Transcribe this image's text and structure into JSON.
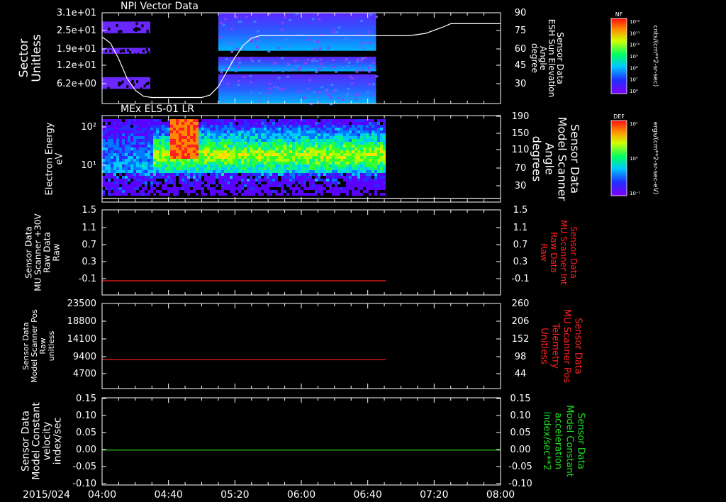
{
  "date_label": "2015/024",
  "time_ticks": [
    "04:00",
    "04:40",
    "05:20",
    "06:00",
    "06:40",
    "07:20",
    "08:00"
  ],
  "colorbars": [
    {
      "tag": "NF",
      "units": "cnts/(cm**2-sr-sec)",
      "tick_labels": [
        "10¹²",
        "10¹¹",
        "10¹⁰",
        "10⁹",
        "10⁸",
        "10⁷",
        "10⁶"
      ]
    },
    {
      "tag": "DEF",
      "units": "ergs/(cm**2-sr-sec-eV)",
      "tick_labels": [
        "10¹",
        "10⁰",
        "10⁻¹"
      ]
    }
  ],
  "chart_data": [
    {
      "type": "heatmap",
      "title": "NPI Vector Data",
      "ylabel_left": [
        "Sector",
        "Unitless"
      ],
      "yticks_left": [
        "3.1e+01",
        "2.5e+01",
        "1.9e+01",
        "1.2e+01",
        "6.2e+00"
      ],
      "ylabel_right": [
        "Sensor Data",
        "ESH Sun Elevation",
        "Angle",
        "degree"
      ],
      "yticks_right": [
        "90",
        "75",
        "60",
        "45",
        "30"
      ],
      "ylim_right": [
        15,
        90
      ],
      "right_series": {
        "color": "#ffffff",
        "points": [
          [
            "04:00",
            70
          ],
          [
            "04:05",
            65
          ],
          [
            "04:10",
            52
          ],
          [
            "04:15",
            36
          ],
          [
            "04:20",
            26
          ],
          [
            "04:25",
            21
          ],
          [
            "04:30",
            20
          ],
          [
            "04:40",
            20
          ],
          [
            "05:00",
            20
          ],
          [
            "05:05",
            22
          ],
          [
            "05:10",
            29
          ],
          [
            "05:15",
            41
          ],
          [
            "05:20",
            53
          ],
          [
            "05:25",
            63
          ],
          [
            "05:30",
            69
          ],
          [
            "05:35",
            71
          ],
          [
            "06:00",
            71
          ],
          [
            "06:30",
            71
          ],
          [
            "06:50",
            71
          ],
          [
            "07:05",
            71
          ],
          [
            "07:15",
            73
          ],
          [
            "07:25",
            78
          ],
          [
            "07:30",
            81
          ],
          [
            "08:00",
            81
          ]
        ]
      },
      "data_blocks": [
        {
          "t_start": "04:00",
          "t_end": "04:29",
          "sector_bands": [
            [
              24,
              28
            ],
            [
              17,
              19
            ],
            [
              5,
              9
            ]
          ],
          "level": "low"
        },
        {
          "t_start": "05:10",
          "t_end": "06:45",
          "sector_bands": [
            [
              18,
              31
            ],
            [
              11,
              16
            ],
            [
              0,
              10
            ]
          ],
          "level": "low-mid"
        }
      ]
    },
    {
      "type": "heatmap",
      "title": "MEx ELS-01 LR",
      "ylabel_left": [
        "Electron Energy",
        "eV"
      ],
      "yticks_left": [
        "10²",
        "10¹"
      ],
      "ylabel_right": [
        "Sensor Data",
        "Model Scanner",
        "Angle",
        "degrees"
      ],
      "yticks_right": [
        "190",
        "150",
        "110",
        "70",
        "30"
      ],
      "ylim_right": [
        10,
        190
      ],
      "right_series": {
        "color": "#ffffff",
        "points": [
          [
            "04:00",
            18
          ],
          [
            "08:00",
            18
          ]
        ]
      },
      "data_extent": [
        "04:00",
        "06:50"
      ],
      "features": [
        {
          "t_start": "04:40",
          "t_end": "04:57",
          "energy_range": [
            10,
            150
          ],
          "level": "high"
        },
        {
          "t_start": "04:30",
          "t_end": "06:50",
          "energy_range": [
            5,
            30
          ],
          "level": "mid"
        }
      ]
    },
    {
      "type": "line",
      "ylabel_left": [
        "Sensor Data",
        "MU Scanner +30V",
        "Raw Data",
        "Raw"
      ],
      "yticks_left": [
        "1.5",
        "1.1",
        "0.7",
        "0.3",
        "-0.1"
      ],
      "ylim": [
        -0.3,
        1.5
      ],
      "ylabel_right": [
        "Sensor Data",
        "MU Scanner Int",
        "Raw Data",
        "Raw"
      ],
      "yticks_right": [
        "1.5",
        "1.1",
        "0.7",
        "0.3",
        "-0.1"
      ],
      "series": [
        {
          "color": "#ff2020",
          "points": [
            [
              "04:00",
              0.0
            ],
            [
              "06:51",
              0.0
            ]
          ]
        }
      ]
    },
    {
      "type": "line",
      "ylabel_left": [
        "Sensor Data",
        "Model Scanner Pos",
        "Raw",
        "unitless"
      ],
      "yticks_left": [
        "23500",
        "18800",
        "14100",
        "9400",
        "4700"
      ],
      "ylim": [
        0,
        23500
      ],
      "ylabel_right": [
        "Sensor Data",
        "MU Scanner Pos",
        "Telemetry",
        "Unitless"
      ],
      "yticks_right": [
        "260",
        "206",
        "152",
        "98",
        "44"
      ],
      "series": [
        {
          "color": "#ff2020",
          "points": [
            [
              "04:00",
              7980
            ],
            [
              "06:51",
              7980
            ]
          ]
        }
      ]
    },
    {
      "type": "line",
      "ylabel_left": [
        "Sensor Data",
        "Model Constant",
        "velocity",
        "index/sec"
      ],
      "yticks_left": [
        "0.15",
        "0.10",
        "0.05",
        "0.00",
        "-0.05",
        "-0.10"
      ],
      "ylim": [
        -0.1,
        0.15
      ],
      "ylabel_right": [
        "Sensor Data",
        "Model Constant",
        "acceleration",
        "index/sec**2"
      ],
      "yticks_right": [
        "0.15",
        "0.10",
        "0.05",
        "0.00",
        "-0.05",
        "-0.10"
      ],
      "series": [
        {
          "color": "#20e020",
          "points": [
            [
              "04:00",
              0.0
            ],
            [
              "08:00",
              0.0
            ]
          ]
        }
      ]
    }
  ]
}
